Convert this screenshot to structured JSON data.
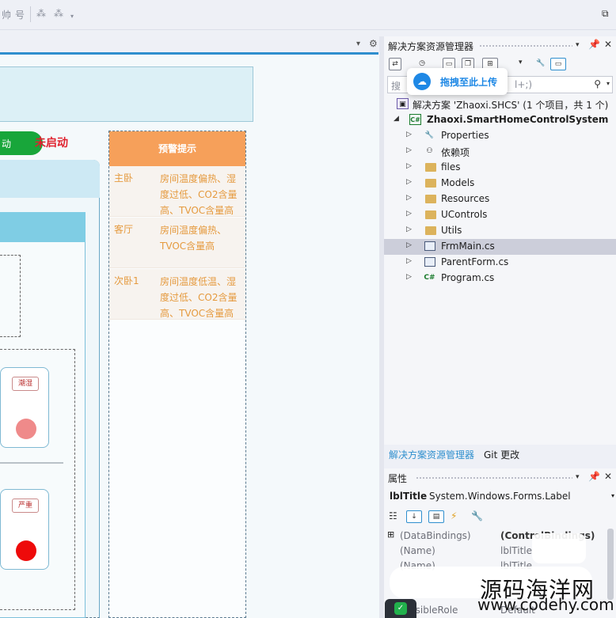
{
  "colors": {
    "accent": "#2f8fce",
    "status_green": "#18a63a",
    "status_red": "#e0212e",
    "warn_orange": "#f6a05a",
    "warn_text": "#e59a3e",
    "selection": "#ccceda"
  },
  "toolbar": {
    "glyph1": "帅",
    "glyph2": "号",
    "right_icon": "layout-icon"
  },
  "designer": {
    "status_button_label": "动",
    "status_text": "未启动",
    "warning_header": "预警提示",
    "warnings": [
      {
        "room": "主卧",
        "message": "房间温度偏热、湿度过低、CO2含量高、TVOC含量高"
      },
      {
        "room": "客厅",
        "message": "房间温度偏热、TVOC含量高"
      },
      {
        "room": "次卧1",
        "message": "房间温度低温、湿度过低、CO2含量高、TVOC含量高"
      }
    ],
    "card_badges": [
      "潮湿",
      "严重"
    ],
    "card_dot_colors": [
      "#ef8a8a",
      "#ee0a0a"
    ]
  },
  "solution_explorer": {
    "title": "解决方案资源管理器",
    "search_placeholder": "搜",
    "search_hint": "l+;)",
    "upload_popup": "拖拽至此上传",
    "tree": [
      {
        "label": "解决方案 'Zhaoxi.SHCS' (1 个项目，共 1 个)",
        "icon": "solution-icon",
        "indent": 0,
        "arrow": ""
      },
      {
        "label": "Zhaoxi.SmartHomeControlSystem",
        "icon": "csharp-project-icon",
        "indent": 1,
        "arrow": "◢",
        "bold": true
      },
      {
        "label": "Properties",
        "icon": "wrench-icon",
        "indent": 2,
        "arrow": "▷"
      },
      {
        "label": "依赖项",
        "icon": "dependencies-icon",
        "indent": 2,
        "arrow": "▷"
      },
      {
        "label": "files",
        "icon": "folder-icon",
        "indent": 2,
        "arrow": "▷"
      },
      {
        "label": "Models",
        "icon": "folder-icon",
        "indent": 2,
        "arrow": "▷"
      },
      {
        "label": "Resources",
        "icon": "folder-icon",
        "indent": 2,
        "arrow": "▷"
      },
      {
        "label": "UControls",
        "icon": "folder-icon",
        "indent": 2,
        "arrow": "▷"
      },
      {
        "label": "Utils",
        "icon": "folder-icon",
        "indent": 2,
        "arrow": "▷"
      },
      {
        "label": "FrmMain.cs",
        "icon": "form-icon",
        "indent": 2,
        "arrow": "▷",
        "selected": true
      },
      {
        "label": "ParentForm.cs",
        "icon": "form-icon",
        "indent": 2,
        "arrow": "▷"
      },
      {
        "label": "Program.cs",
        "icon": "csharp-file-icon",
        "indent": 2,
        "arrow": "▷"
      }
    ],
    "tabs": [
      "解决方案资源管理器",
      "Git 更改"
    ]
  },
  "properties": {
    "title": "属性",
    "object_name": "lblTitle",
    "object_type": "System.Windows.Forms.Label",
    "rows": [
      {
        "key": "(DataBindings)",
        "value": "(ControlBindings)",
        "expand": "⊞"
      },
      {
        "key": "(Name)",
        "value": "lblTitle",
        "expand": ""
      },
      {
        "key": "(Name)",
        "value": "lblTitle",
        "expand": ""
      }
    ],
    "partial_row": {
      "key": "essibleRole",
      "value": "Default"
    }
  },
  "watermark": {
    "text": "源码海洋网",
    "url": "www.codehy.com"
  }
}
